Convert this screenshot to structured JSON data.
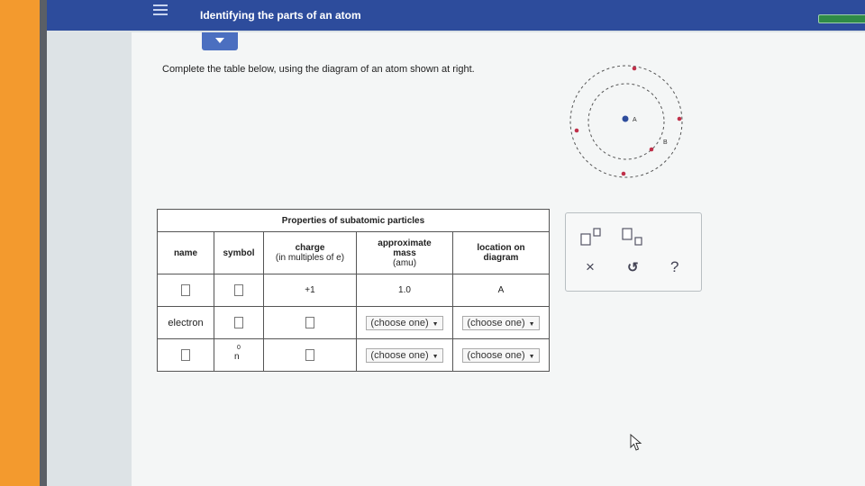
{
  "header": {
    "title": "Identifying the parts of an atom"
  },
  "instruction": "Complete the table below, using the diagram of an atom shown at right.",
  "diagram": {
    "label_a": "A",
    "label_b": "B"
  },
  "table": {
    "caption": "Properties of subatomic particles",
    "headers": {
      "name": "name",
      "symbol": "symbol",
      "charge": "charge",
      "charge_sub": "(in multiples of e)",
      "mass": "approximate mass",
      "mass_sub": "(amu)",
      "location": "location on diagram"
    },
    "rows": [
      {
        "charge": "+1",
        "mass": "1.0",
        "location": "A"
      },
      {
        "name": "electron",
        "mass_select": "(choose one)",
        "location_select": "(choose one)"
      },
      {
        "symbol_letter": "n",
        "symbol_sup": "0",
        "mass_select": "(choose one)",
        "location_select": "(choose one)"
      }
    ]
  },
  "tools": {
    "clear": "×",
    "undo": "↺",
    "help": "?"
  },
  "colors": {
    "header_bg": "#2d4c9c",
    "accent": "#4b6fc0",
    "proton": "#c0304a",
    "nucleus": "#2d4c9c"
  }
}
